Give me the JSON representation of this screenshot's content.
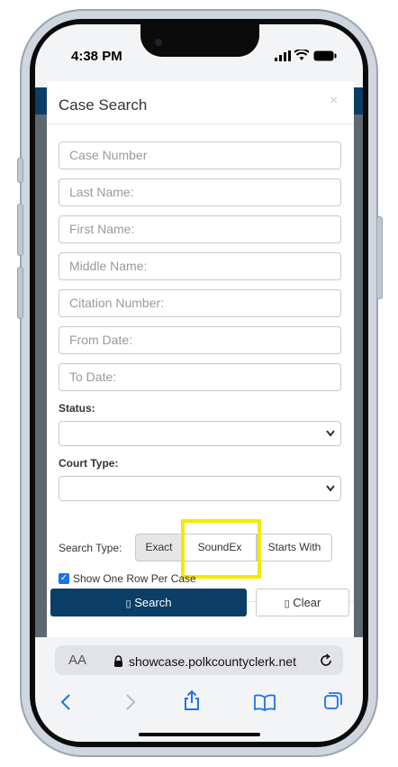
{
  "status_bar": {
    "time": "4:38 PM"
  },
  "modal": {
    "title": "Case Search",
    "close": "×",
    "fields": [
      {
        "placeholder": "Case Number"
      },
      {
        "placeholder": "Last Name:"
      },
      {
        "placeholder": "First Name:"
      },
      {
        "placeholder": "Middle Name:"
      },
      {
        "placeholder": "Citation Number:"
      },
      {
        "placeholder": "From Date:"
      },
      {
        "placeholder": "To Date:"
      }
    ],
    "status_label": "Status:",
    "court_type_label": "Court Type:",
    "search_type_label": "Search Type:",
    "search_type_options": [
      "Exact",
      "SoundEx",
      "Starts With"
    ],
    "selected_search_type": "Exact",
    "show_one_row_label": "Show One Row Per Case",
    "show_one_row_checked": true,
    "search_button": "Search",
    "clear_button": "Clear"
  },
  "browser": {
    "aa_label": "AA",
    "url": "showcase.polkcountyclerk.net",
    "toolbar_icons": [
      "back-icon",
      "forward-icon",
      "share-icon",
      "bookmarks-icon",
      "tabs-icon"
    ]
  },
  "colors": {
    "primary": "#0b3e66",
    "highlight": "#f5e900",
    "checkbox": "#1a73e8"
  }
}
